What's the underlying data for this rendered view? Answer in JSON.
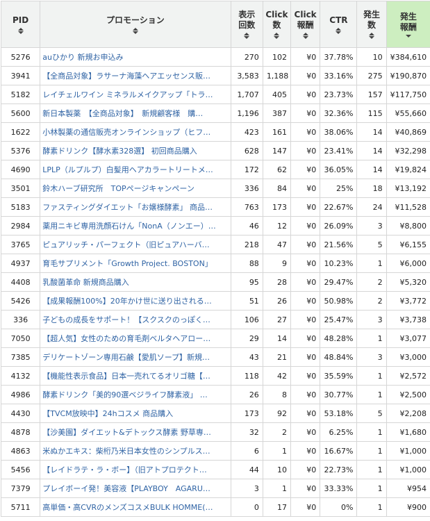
{
  "headers": {
    "pid": "PID",
    "promotion": "プロモーション",
    "impressions": "表示\n回数",
    "clicks": "Click\n数",
    "click_reward": "Click\n報酬",
    "ctr": "CTR",
    "occurrences": "発生\n数",
    "occurrence_reward": "発生\n報酬"
  },
  "sorted_column": "occurrence_reward",
  "sort_direction": "desc",
  "rows": [
    {
      "pid": "5276",
      "promotion": "auひかり 新規お申込み",
      "impressions": "270",
      "clicks": "102",
      "click_reward": "¥0",
      "ctr": "37.78%",
      "occurrences": "10",
      "occurrence_reward": "¥384,610"
    },
    {
      "pid": "3941",
      "promotion": "【全商品対象】ラサーナ海藻ヘアエッセンス販…",
      "impressions": "3,583",
      "clicks": "1,188",
      "click_reward": "¥0",
      "ctr": "33.16%",
      "occurrences": "275",
      "occurrence_reward": "¥190,870"
    },
    {
      "pid": "5182",
      "promotion": "レイチェルワイン ミネラルメイクアップ「トラ…",
      "impressions": "1,707",
      "clicks": "405",
      "click_reward": "¥0",
      "ctr": "23.73%",
      "occurrences": "157",
      "occurrence_reward": "¥117,750"
    },
    {
      "pid": "5600",
      "promotion": "新日本製薬　【全商品対象】　新規顧客様　購…",
      "impressions": "1,196",
      "clicks": "387",
      "click_reward": "¥0",
      "ctr": "32.36%",
      "occurrences": "115",
      "occurrence_reward": "¥55,660"
    },
    {
      "pid": "1622",
      "promotion": "小林製薬の通信販売オンラインショップ（ヒフ…",
      "impressions": "423",
      "clicks": "161",
      "click_reward": "¥0",
      "ctr": "38.06%",
      "occurrences": "14",
      "occurrence_reward": "¥40,869"
    },
    {
      "pid": "5376",
      "promotion": "酵素ドリンク【酵水素328選】 初回商品購入",
      "impressions": "628",
      "clicks": "147",
      "click_reward": "¥0",
      "ctr": "23.41%",
      "occurrences": "14",
      "occurrence_reward": "¥32,298"
    },
    {
      "pid": "4690",
      "promotion": "LPLP（ルプルプ）白髪用ヘアカラートリートメ…",
      "impressions": "172",
      "clicks": "62",
      "click_reward": "¥0",
      "ctr": "36.05%",
      "occurrences": "14",
      "occurrence_reward": "¥19,824"
    },
    {
      "pid": "3501",
      "promotion": "鈴木ハーブ研究所　TOPページキャンペーン",
      "impressions": "336",
      "clicks": "84",
      "click_reward": "¥0",
      "ctr": "25%",
      "occurrences": "18",
      "occurrence_reward": "¥13,192"
    },
    {
      "pid": "5183",
      "promotion": "ファスティングダイエット「お嬢様酵素」 商品…",
      "impressions": "763",
      "clicks": "173",
      "click_reward": "¥0",
      "ctr": "22.67%",
      "occurrences": "24",
      "occurrence_reward": "¥11,528"
    },
    {
      "pid": "2984",
      "promotion": "薬用ニキビ専用洗顔石けん「NonA（ノンエー）…",
      "impressions": "46",
      "clicks": "12",
      "click_reward": "¥0",
      "ctr": "26.09%",
      "occurrences": "3",
      "occurrence_reward": "¥8,800"
    },
    {
      "pid": "3765",
      "promotion": "ピュアリッチ・パーフェクト（旧ピュアハーバ…",
      "impressions": "218",
      "clicks": "47",
      "click_reward": "¥0",
      "ctr": "21.56%",
      "occurrences": "5",
      "occurrence_reward": "¥6,155"
    },
    {
      "pid": "4937",
      "promotion": "育毛サプリメント「Growth Project. BOSTON」",
      "impressions": "88",
      "clicks": "9",
      "click_reward": "¥0",
      "ctr": "10.23%",
      "occurrences": "1",
      "occurrence_reward": "¥6,000"
    },
    {
      "pid": "4408",
      "promotion": "乳酸菌革命 新規商品購入",
      "impressions": "95",
      "clicks": "28",
      "click_reward": "¥0",
      "ctr": "29.47%",
      "occurrences": "2",
      "occurrence_reward": "¥5,320"
    },
    {
      "pid": "5426",
      "promotion": "【成果報酬100%】20年かけ世に送り出される…",
      "impressions": "51",
      "clicks": "26",
      "click_reward": "¥0",
      "ctr": "50.98%",
      "occurrences": "2",
      "occurrence_reward": "¥3,772"
    },
    {
      "pid": "336",
      "promotion": "子どもの成長をサポート！【スクスクのっぽく…",
      "impressions": "106",
      "clicks": "27",
      "click_reward": "¥0",
      "ctr": "25.47%",
      "occurrences": "3",
      "occurrence_reward": "¥3,738"
    },
    {
      "pid": "7050",
      "promotion": "【超人気】女性のための育毛剤ベルタヘアロー…",
      "impressions": "29",
      "clicks": "14",
      "click_reward": "¥0",
      "ctr": "48.28%",
      "occurrences": "1",
      "occurrence_reward": "¥3,077"
    },
    {
      "pid": "7385",
      "promotion": "デリケートゾーン専用石鹸【愛肌ソープ】新規…",
      "impressions": "43",
      "clicks": "21",
      "click_reward": "¥0",
      "ctr": "48.84%",
      "occurrences": "3",
      "occurrence_reward": "¥3,000"
    },
    {
      "pid": "4132",
      "promotion": "【機能性表示食品】日本一売れてるオリゴ糖【…",
      "impressions": "118",
      "clicks": "42",
      "click_reward": "¥0",
      "ctr": "35.59%",
      "occurrences": "1",
      "occurrence_reward": "¥2,572"
    },
    {
      "pid": "4986",
      "promotion": "酵素ドリンク「美的90選ベジライフ酵素液」 …",
      "impressions": "26",
      "clicks": "8",
      "click_reward": "¥0",
      "ctr": "30.77%",
      "occurrences": "1",
      "occurrence_reward": "¥2,500"
    },
    {
      "pid": "4430",
      "promotion": "【TVCM放映中】24hコスメ 商品購入",
      "impressions": "173",
      "clicks": "92",
      "click_reward": "¥0",
      "ctr": "53.18%",
      "occurrences": "5",
      "occurrence_reward": "¥2,208"
    },
    {
      "pid": "4878",
      "promotion": "【沙美園】ダイエット&デトックス酵素 野草専…",
      "impressions": "32",
      "clicks": "2",
      "click_reward": "¥0",
      "ctr": "6.25%",
      "occurrences": "1",
      "occurrence_reward": "¥1,680"
    },
    {
      "pid": "4863",
      "promotion": "米ぬかエキス：柴桁乃米日本女性のシンプルス…",
      "impressions": "6",
      "clicks": "1",
      "click_reward": "¥0",
      "ctr": "16.67%",
      "occurrences": "1",
      "occurrence_reward": "¥1,000"
    },
    {
      "pid": "5456",
      "promotion": "【レイドラテ・ラ・ボー】（旧アトプロテクト…",
      "impressions": "44",
      "clicks": "10",
      "click_reward": "¥0",
      "ctr": "22.73%",
      "occurrences": "1",
      "occurrence_reward": "¥1,000"
    },
    {
      "pid": "7379",
      "promotion": "プレイボーイ発！美容液【PLAYBOY　AGARU…",
      "impressions": "3",
      "clicks": "1",
      "click_reward": "¥0",
      "ctr": "33.33%",
      "occurrences": "1",
      "occurrence_reward": "¥954"
    },
    {
      "pid": "5711",
      "promotion": "高単価・高CVRのメンズコスメBULK HOMME(…",
      "impressions": "0",
      "clicks": "17",
      "click_reward": "¥0",
      "ctr": "0%",
      "occurrences": "1",
      "occurrence_reward": "¥900"
    }
  ]
}
